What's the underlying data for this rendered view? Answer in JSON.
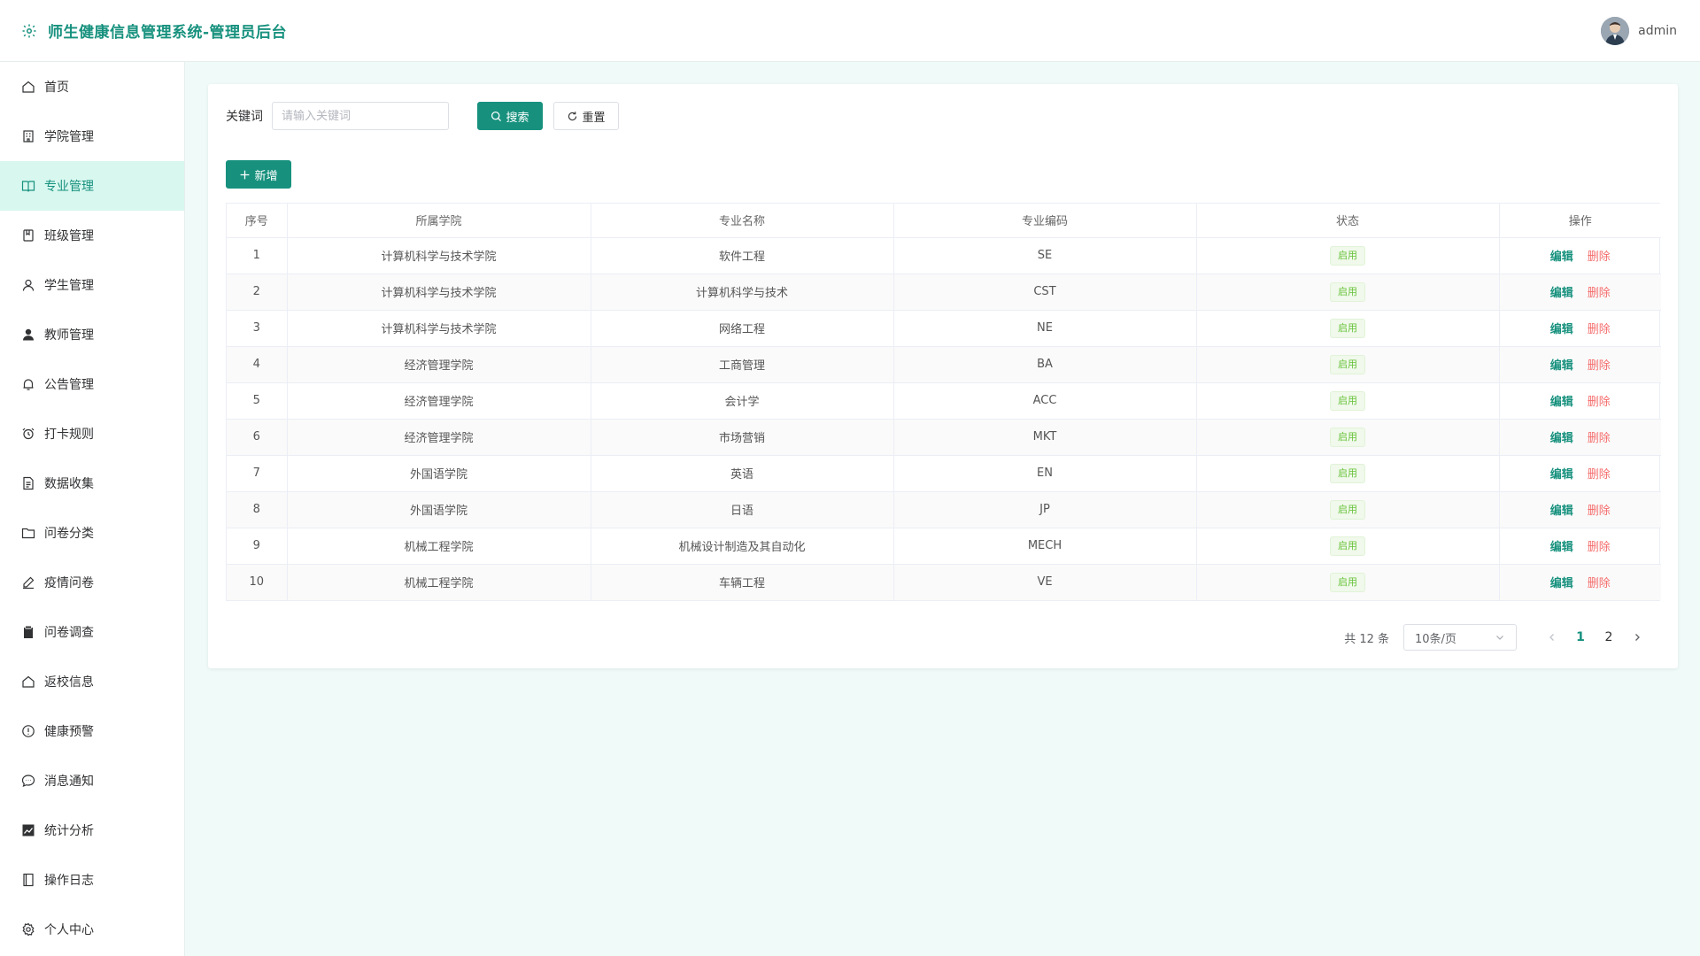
{
  "header": {
    "title": "师生健康信息管理系统-管理员后台",
    "username": "admin"
  },
  "sidebar": {
    "items": [
      {
        "label": "首页",
        "icon": "home-icon"
      },
      {
        "label": "学院管理",
        "icon": "building-icon"
      },
      {
        "label": "专业管理",
        "icon": "book-icon",
        "active": true
      },
      {
        "label": "班级管理",
        "icon": "notebook-icon"
      },
      {
        "label": "学生管理",
        "icon": "user-icon"
      },
      {
        "label": "教师管理",
        "icon": "user-filled-icon"
      },
      {
        "label": "公告管理",
        "icon": "bell-icon"
      },
      {
        "label": "打卡规则",
        "icon": "alarm-clock-icon"
      },
      {
        "label": "数据收集",
        "icon": "document-icon"
      },
      {
        "label": "问卷分类",
        "icon": "folder-icon"
      },
      {
        "label": "疫情问卷",
        "icon": "edit-pen-icon"
      },
      {
        "label": "问卷调查",
        "icon": "clipboard-icon"
      },
      {
        "label": "返校信息",
        "icon": "house-icon"
      },
      {
        "label": "健康预警",
        "icon": "warning-icon"
      },
      {
        "label": "消息通知",
        "icon": "chat-icon"
      },
      {
        "label": "统计分析",
        "icon": "chart-icon"
      },
      {
        "label": "操作日志",
        "icon": "log-book-icon"
      },
      {
        "label": "个人中心",
        "icon": "settings-icon"
      }
    ]
  },
  "search": {
    "label": "关键词",
    "placeholder": "请输入关键词",
    "search_label": "搜索",
    "reset_label": "重置"
  },
  "toolbar": {
    "add_label": "新增"
  },
  "table": {
    "columns": [
      "序号",
      "所属学院",
      "专业名称",
      "专业编码",
      "状态",
      "操作"
    ],
    "edit_label": "编辑",
    "delete_label": "删除",
    "rows": [
      {
        "index": "1",
        "college": "计算机科学与技术学院",
        "major": "软件工程",
        "code": "SE",
        "status": "启用"
      },
      {
        "index": "2",
        "college": "计算机科学与技术学院",
        "major": "计算机科学与技术",
        "code": "CST",
        "status": "启用"
      },
      {
        "index": "3",
        "college": "计算机科学与技术学院",
        "major": "网络工程",
        "code": "NE",
        "status": "启用"
      },
      {
        "index": "4",
        "college": "经济管理学院",
        "major": "工商管理",
        "code": "BA",
        "status": "启用"
      },
      {
        "index": "5",
        "college": "经济管理学院",
        "major": "会计学",
        "code": "ACC",
        "status": "启用"
      },
      {
        "index": "6",
        "college": "经济管理学院",
        "major": "市场营销",
        "code": "MKT",
        "status": "启用"
      },
      {
        "index": "7",
        "college": "外国语学院",
        "major": "英语",
        "code": "EN",
        "status": "启用"
      },
      {
        "index": "8",
        "college": "外国语学院",
        "major": "日语",
        "code": "JP",
        "status": "启用"
      },
      {
        "index": "9",
        "college": "机械工程学院",
        "major": "机械设计制造及其自动化",
        "code": "MECH",
        "status": "启用"
      },
      {
        "index": "10",
        "college": "机械工程学院",
        "major": "车辆工程",
        "code": "VE",
        "status": "启用"
      }
    ]
  },
  "pagination": {
    "total_text": "共 12 条",
    "page_size": "10条/页",
    "pages": [
      "1",
      "2"
    ],
    "current": "1"
  },
  "colors": {
    "primary": "#17917e",
    "active_bg": "#d8f7ef",
    "danger": "#f56c6c",
    "success": "#67c23a"
  }
}
